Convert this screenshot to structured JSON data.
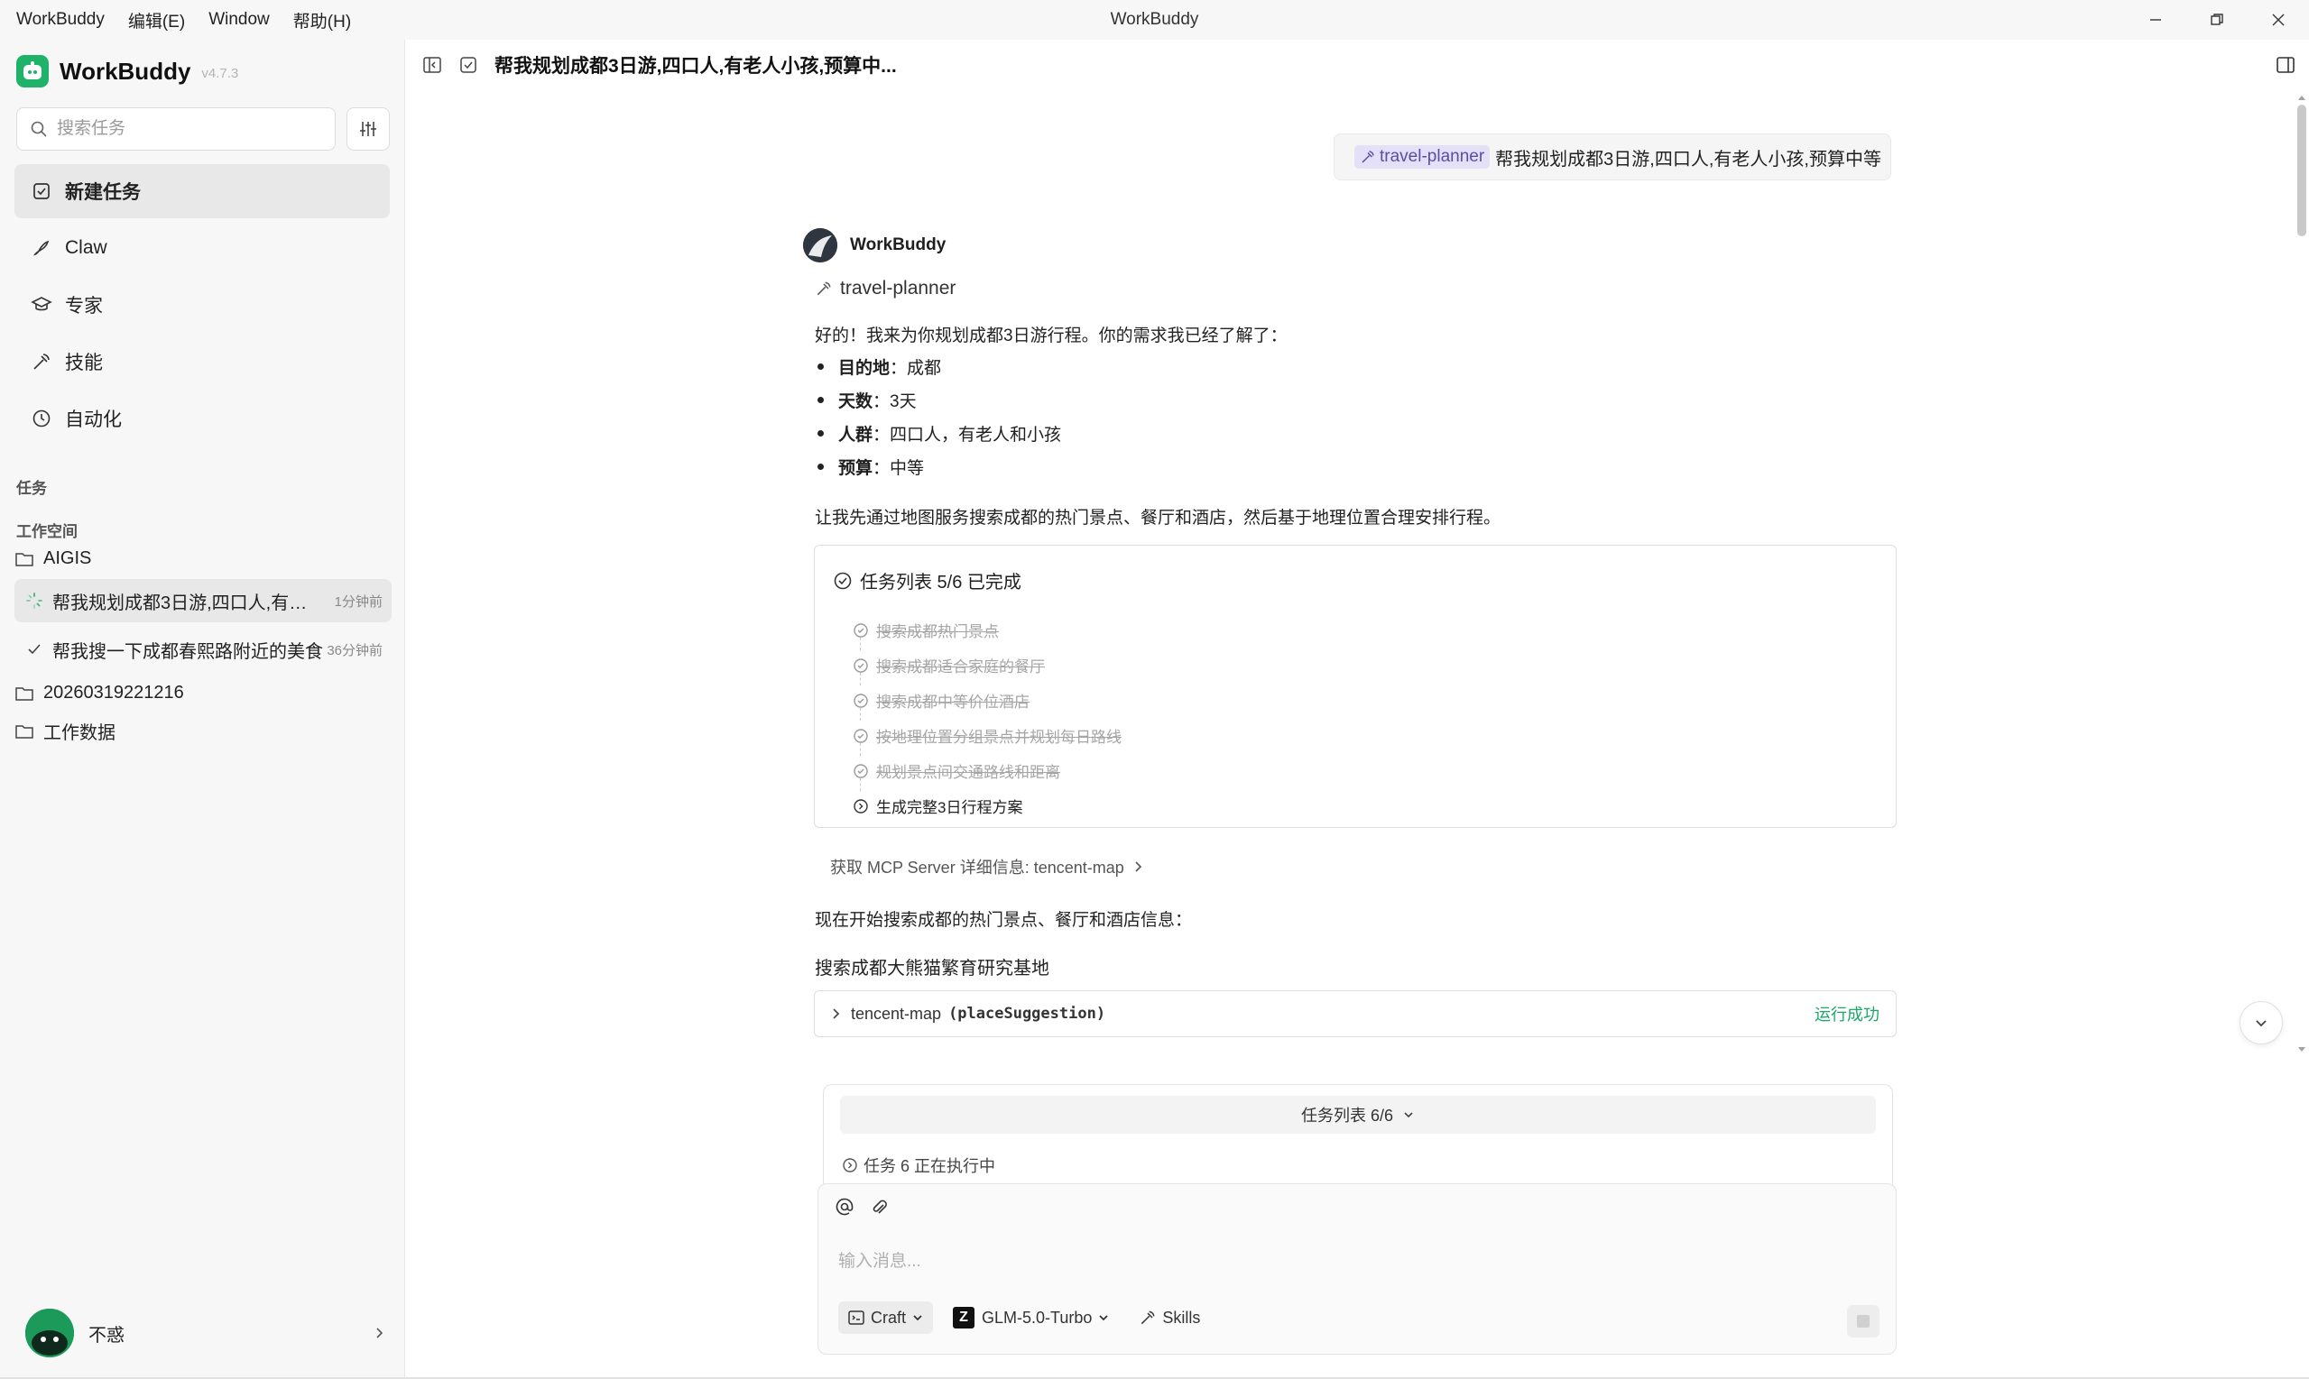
{
  "menubar": {
    "items": [
      "WorkBuddy",
      "编辑(E)",
      "Window",
      "帮助(H)"
    ],
    "window_title": "WorkBuddy"
  },
  "sidebar": {
    "app_name": "WorkBuddy",
    "version": "v4.7.3",
    "search_placeholder": "搜索任务",
    "nav": [
      {
        "label": "新建任务",
        "icon": "new-task-icon"
      },
      {
        "label": "Claw",
        "icon": "claw-icon"
      },
      {
        "label": "专家",
        "icon": "expert-icon"
      },
      {
        "label": "技能",
        "icon": "skill-icon"
      },
      {
        "label": "自动化",
        "icon": "clock-icon"
      }
    ],
    "tasks_label": "任务",
    "workspace_label": "工作空间",
    "folders": [
      "AIGIS",
      "20260319221216",
      "工作数据"
    ],
    "tasks": [
      {
        "title": "帮我规划成都3日游,四口人,有老人小孩,预算中等",
        "time": "1分钟前"
      },
      {
        "title": "帮我搜一下成都春熙路附近的美食",
        "time": "36分钟前"
      }
    ],
    "user_name": "不惑"
  },
  "conversation": {
    "title": "帮我规划成都3日游,四口人,有老人小孩,预算中...",
    "user_message": {
      "skill": "travel-planner",
      "text": "帮我规划成都3日游,四口人,有老人小孩,预算中等"
    },
    "bot_name": "WorkBuddy",
    "skill_used": "travel-planner",
    "intro": "好的！我来为你规划成都3日游行程。你的需求我已经了解了：",
    "requirements": [
      {
        "key": "目的地",
        "value": "：成都"
      },
      {
        "key": "天数",
        "value": "：3天"
      },
      {
        "key": "人群",
        "value": "：四口人，有老人和小孩"
      },
      {
        "key": "预算",
        "value": "：中等"
      }
    ],
    "plan_text": "让我先通过地图服务搜索成都的热门景点、餐厅和酒店，然后基于地理位置合理安排行程。",
    "todo": {
      "header": "任务列表 5/6 已完成",
      "items": [
        "搜索成都热门景点",
        "搜索成都适合家庭的餐厅",
        "搜索成都中等价位酒店",
        "按地理位置分组景点并规划每日路线",
        "规划景点间交通路线和距离",
        "生成完整3日行程方案"
      ],
      "done_count": 5
    },
    "mcp_info": "获取 MCP Server 详细信息: tencent-map",
    "search_intro": "现在开始搜索成都的热门景点、餐厅和酒店信息：",
    "search_title": "搜索成都大熊猫繁育研究基地",
    "tool_call": {
      "server": "tencent-map",
      "function": "(placeSuggestion)",
      "status": "运行成功"
    }
  },
  "composer": {
    "task_panel_label": "任务列表 6/6",
    "task_running": "任务 6 正在执行中",
    "placeholder": "输入消息...",
    "mode": "Craft",
    "model": "GLM-5.0-Turbo",
    "skills_label": "Skills"
  },
  "colors": {
    "accent_green": "#1fb36a",
    "success": "#1aa86a",
    "skill_chip_bg": "#e4e0f7",
    "skill_chip_text": "#5a4ea3"
  }
}
